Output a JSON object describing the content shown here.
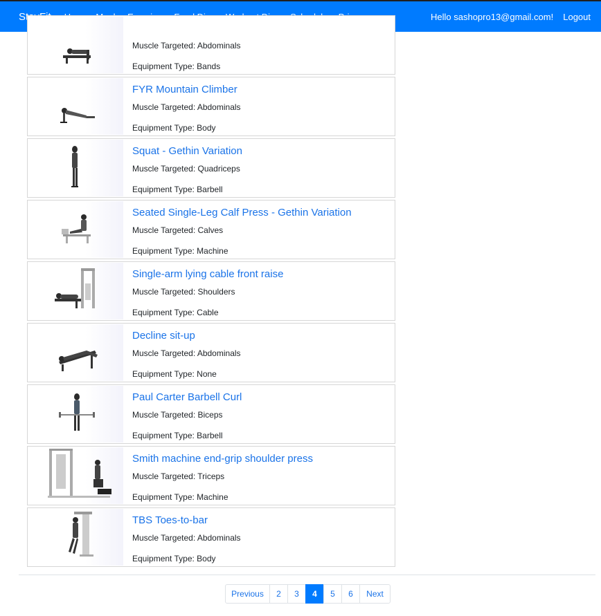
{
  "navbar": {
    "brand": "StayFit",
    "links": [
      "Home",
      "Meals",
      "Exercises",
      "Food Diary",
      "Workout Diary",
      "Scheduler",
      "Privacy"
    ],
    "greeting": "Hello sashopro13@gmail.com!",
    "logout": "Logout"
  },
  "exercises": [
    {
      "title": "",
      "muscle": "Muscle Targeted: Abdominals",
      "equipment": "Equipment Type: Bands",
      "image": "exercise-bench-figure"
    },
    {
      "title": "FYR Mountain Climber",
      "muscle": "Muscle Targeted: Abdominals",
      "equipment": "Equipment Type: Body",
      "image": "exercise-plank-figure"
    },
    {
      "title": "Squat - Gethin Variation",
      "muscle": "Muscle Targeted: Quadriceps",
      "equipment": "Equipment Type: Barbell",
      "image": "exercise-standing-figure"
    },
    {
      "title": "Seated Single-Leg Calf Press - Gethin Variation",
      "muscle": "Muscle Targeted: Calves",
      "equipment": "Equipment Type: Machine",
      "image": "exercise-seated-machine-figure"
    },
    {
      "title": "Single-arm lying cable front raise",
      "muscle": "Muscle Targeted: Shoulders",
      "equipment": "Equipment Type: Cable",
      "image": "exercise-cable-machine-figure"
    },
    {
      "title": "Decline sit-up",
      "muscle": "Muscle Targeted: Abdominals",
      "equipment": "Equipment Type: None",
      "image": "exercise-decline-bench-figure"
    },
    {
      "title": "Paul Carter Barbell Curl",
      "muscle": "Muscle Targeted: Biceps",
      "equipment": "Equipment Type: Barbell",
      "image": "exercise-barbell-figure"
    },
    {
      "title": "Smith machine end-grip shoulder press",
      "muscle": "Muscle Targeted: Triceps",
      "equipment": "Equipment Type: Machine",
      "image": "exercise-smith-machine-figure"
    },
    {
      "title": "TBS Toes-to-bar",
      "muscle": "Muscle Targeted: Abdominals",
      "equipment": "Equipment Type: Body",
      "image": "exercise-hanging-figure"
    }
  ],
  "pagination": {
    "previous": "Previous",
    "pages": [
      "2",
      "3",
      "4",
      "5",
      "6"
    ],
    "active": "4",
    "next": "Next"
  },
  "colors": {
    "navbar": "#007bff",
    "link": "#1a73e8",
    "active_page": "#007bff"
  }
}
